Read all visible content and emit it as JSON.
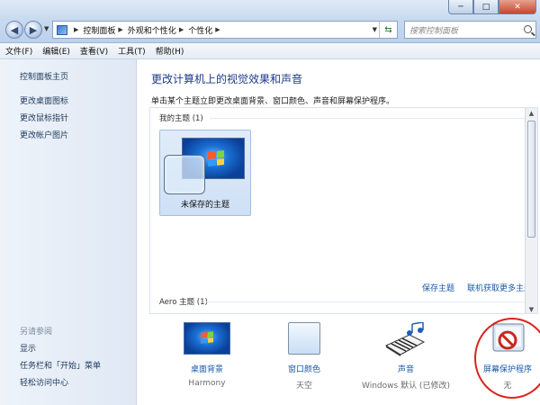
{
  "window": {
    "min_glyph": "─",
    "max_glyph": "□",
    "close_glyph": "✕"
  },
  "address": {
    "crumbs": [
      "控制面板",
      "外观和个性化",
      "个性化"
    ]
  },
  "search": {
    "placeholder": "搜索控制面板"
  },
  "menu": {
    "items": [
      "文件(F)",
      "编辑(E)",
      "查看(V)",
      "工具(T)",
      "帮助(H)"
    ]
  },
  "sidebar": {
    "home": "控制面板主页",
    "links": [
      "更改桌面图标",
      "更改鼠标指针",
      "更改帐户图片"
    ],
    "see_also_heading": "另请参阅",
    "see_also": [
      "显示",
      "任务栏和「开始」菜单",
      "轻松访问中心"
    ]
  },
  "main": {
    "title": "更改计算机上的视觉效果和声音",
    "subtitle": "单击某个主题立即更改桌面背景、窗口颜色、声音和屏幕保护程序。",
    "my_themes_label": "我的主题 (1)",
    "unsaved_theme": "未保存的主题",
    "save_theme": "保存主题",
    "get_more_themes": "联机获取更多主题",
    "aero_label": "Aero 主题 (1)"
  },
  "bottom": [
    {
      "label": "桌面背景",
      "value": "Harmony"
    },
    {
      "label": "窗口颜色",
      "value": "天空"
    },
    {
      "label": "声音",
      "value": "Windows 默认 (已修改)"
    },
    {
      "label": "屏幕保护程序",
      "value": "无"
    }
  ],
  "colors": {
    "link": "#1a5aa8",
    "title": "#1e3a8a",
    "highlight": "#d9241c"
  }
}
